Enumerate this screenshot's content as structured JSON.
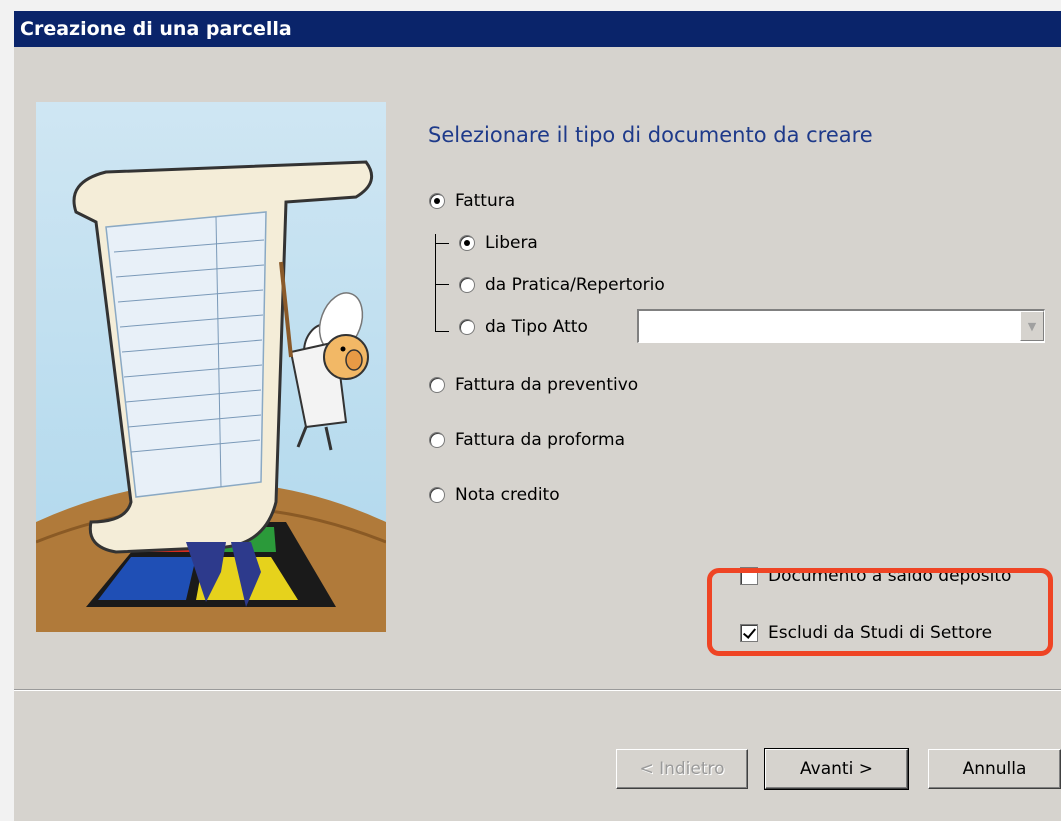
{
  "window": {
    "title": "Creazione di una parcella"
  },
  "heading": "Selezionare il tipo di documento da creare",
  "options": {
    "fattura": {
      "label": "Fattura",
      "checked": true
    },
    "libera": {
      "label": "Libera",
      "checked": true
    },
    "da_pratica": {
      "label": "da Pratica/Repertorio",
      "checked": false
    },
    "da_tipo_atto": {
      "label": "da Tipo Atto",
      "checked": false
    },
    "fattura_preventivo": {
      "label": "Fattura da preventivo",
      "checked": false
    },
    "fattura_proforma": {
      "label": "Fattura da proforma",
      "checked": false
    },
    "nota_credito": {
      "label": "Nota credito",
      "checked": false
    }
  },
  "tipo_atto_combo": {
    "value": ""
  },
  "checkboxes": {
    "saldo_deposito": {
      "label": "Documento a saldo deposito",
      "checked": false
    },
    "escludi_studi": {
      "label": "Escludi da Studi di Settore",
      "checked": true
    }
  },
  "buttons": {
    "back": {
      "label": "< Indietro",
      "enabled": false
    },
    "next": {
      "label": "Avanti >",
      "enabled": true
    },
    "cancel": {
      "label": "Annulla",
      "enabled": true
    }
  },
  "colors": {
    "titlebar": "#0a246a",
    "dialog": "#d6d3ce",
    "heading": "#1e3a8a",
    "highlight": "#ef4424"
  }
}
